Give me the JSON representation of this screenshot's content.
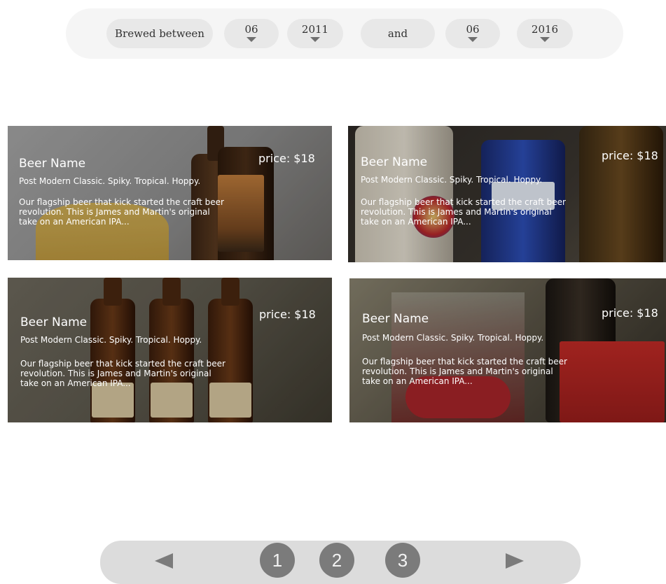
{
  "filter": {
    "label": "Brewed between",
    "from_month": "06",
    "from_year": "2011",
    "conjunction": "and",
    "to_month": "06",
    "to_year": "2016"
  },
  "cards": [
    {
      "name": "Beer Name",
      "tagline": "Post Modern Classic. Spiky. Tropical. Hoppy.",
      "description": "Our flagship beer that kick started the craft beer revolution. This is James and Martin's original take on an American IPA...",
      "price": "price: $18"
    },
    {
      "name": "Beer Name",
      "tagline": "Post Modern Classic. Spiky. Tropical. Hoppy.",
      "description": "Our flagship beer that kick started the craft beer revolution. This is James and Martin's original take on an American IPA...",
      "price": "price: $18"
    },
    {
      "name": "Beer Name",
      "tagline": "Post Modern Classic. Spiky. Tropical. Hoppy.",
      "description": "Our flagship beer that kick started the craft beer revolution. This is James and Martin's original take on an American IPA...",
      "price": "price: $18"
    },
    {
      "name": "Beer Name",
      "tagline": "Post Modern Classic. Spiky. Tropical. Hoppy.",
      "description": "Our flagship beer that kick started the craft beer revolution. This is James and Martin's original take on an American IPA...",
      "price": "price: $18"
    }
  ],
  "pagination": {
    "prev_icon": "triangle-left-icon",
    "next_icon": "triangle-right-icon",
    "pages": [
      "1",
      "2",
      "3"
    ]
  }
}
